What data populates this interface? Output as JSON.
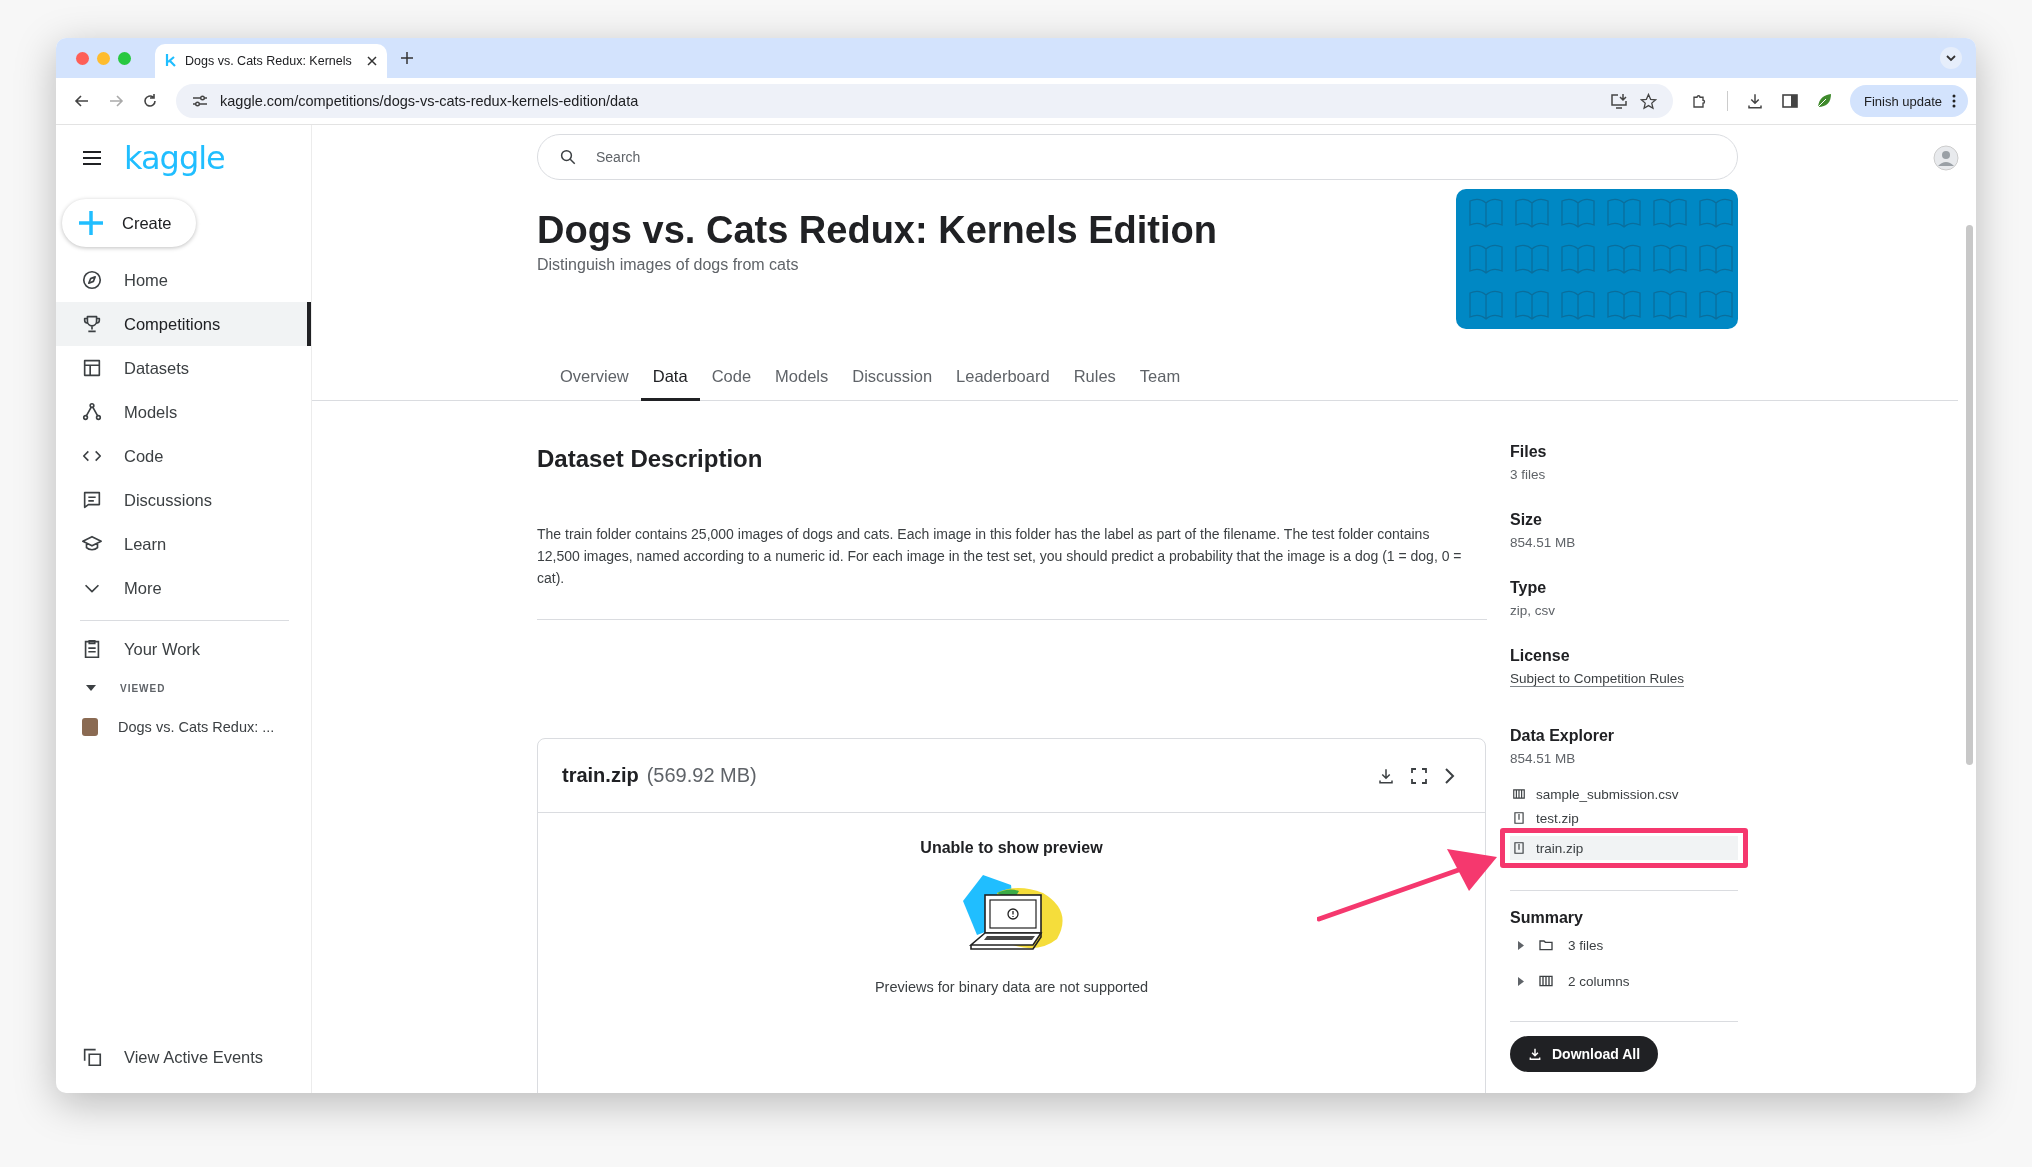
{
  "browser": {
    "tab_title": "Dogs vs. Cats Redux: Kernels",
    "url": "kaggle.com/competitions/dogs-vs-cats-redux-kernels-edition/data",
    "update_button": "Finish update"
  },
  "sidebar": {
    "logo": "kaggle",
    "create": "Create",
    "items": [
      {
        "label": "Home",
        "selected": false
      },
      {
        "label": "Competitions",
        "selected": true
      },
      {
        "label": "Datasets",
        "selected": false
      },
      {
        "label": "Models",
        "selected": false
      },
      {
        "label": "Code",
        "selected": false
      },
      {
        "label": "Discussions",
        "selected": false
      },
      {
        "label": "Learn",
        "selected": false
      },
      {
        "label": "More",
        "selected": false
      }
    ],
    "your_work": "Your Work",
    "viewed_heading": "VIEWED",
    "viewed_items": [
      "Dogs vs. Cats Redux: ..."
    ],
    "footer": "View Active Events"
  },
  "search": {
    "placeholder": "Search"
  },
  "header": {
    "title": "Dogs vs. Cats Redux: Kernels Edition",
    "subtitle": "Distinguish images of dogs from cats"
  },
  "tabs": [
    {
      "label": "Overview",
      "selected": false
    },
    {
      "label": "Data",
      "selected": true
    },
    {
      "label": "Code",
      "selected": false
    },
    {
      "label": "Models",
      "selected": false
    },
    {
      "label": "Discussion",
      "selected": false
    },
    {
      "label": "Leaderboard",
      "selected": false
    },
    {
      "label": "Rules",
      "selected": false
    },
    {
      "label": "Team",
      "selected": false
    }
  ],
  "description": {
    "heading": "Dataset Description",
    "text": "The train folder contains 25,000 images of dogs and cats. Each image in this folder has the label as part of the filename. The test folder contains 12,500 images, named according to a numeric id. For each image in the test set, you should predict a probability that the image is a dog (1 = dog, 0 = cat)."
  },
  "preview": {
    "file_name": "train.zip",
    "file_size": "(569.92 MB)",
    "message_title": "Unable to show preview",
    "message": "Previews for binary data are not supported"
  },
  "details": [
    {
      "label": "Files",
      "value": "3 files",
      "kind": "text"
    },
    {
      "label": "Size",
      "value": "854.51 MB",
      "kind": "text"
    },
    {
      "label": "Type",
      "value": "zip, csv",
      "kind": "text"
    },
    {
      "label": "License",
      "value": "Subject to Competition Rules",
      "kind": "link"
    }
  ],
  "explorer": {
    "heading": "Data Explorer",
    "size": "854.51 MB",
    "files": [
      {
        "name": "sample_submission.csv",
        "kind": "table",
        "selected": false
      },
      {
        "name": "test.zip",
        "kind": "archive",
        "selected": false
      },
      {
        "name": "train.zip",
        "kind": "archive",
        "selected": true
      }
    ]
  },
  "summary": {
    "heading": "Summary",
    "items": [
      {
        "label": "3 files",
        "kind": "folder",
        "expanded": false
      },
      {
        "label": "2 columns",
        "kind": "table",
        "expanded": false
      }
    ]
  },
  "download_all": "Download All"
}
